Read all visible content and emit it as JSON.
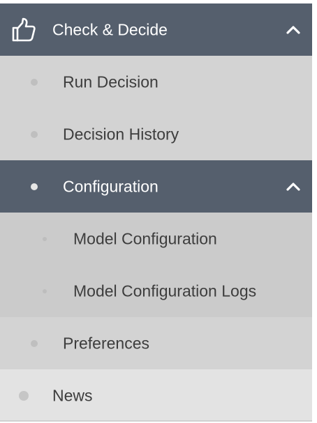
{
  "menu": {
    "header": {
      "icon": "thumbs-up-icon",
      "label": "Check & Decide",
      "expanded": true
    },
    "items": [
      {
        "label": "Run Decision"
      },
      {
        "label": "Decision History"
      },
      {
        "label": "Configuration",
        "expanded": true,
        "active": true,
        "children": [
          {
            "label": "Model Configuration"
          },
          {
            "label": "Model Configuration Logs"
          }
        ]
      },
      {
        "label": "Preferences"
      }
    ],
    "top_items": [
      {
        "label": "News"
      }
    ]
  },
  "colors": {
    "header_bg": "#555f6d",
    "level1_bg": "#d3d3d3",
    "level2_bg": "#cbcbcb",
    "top_item_bg": "#e3e3e3",
    "text_dark": "#3d3d3d",
    "text_light": "#ffffff"
  }
}
